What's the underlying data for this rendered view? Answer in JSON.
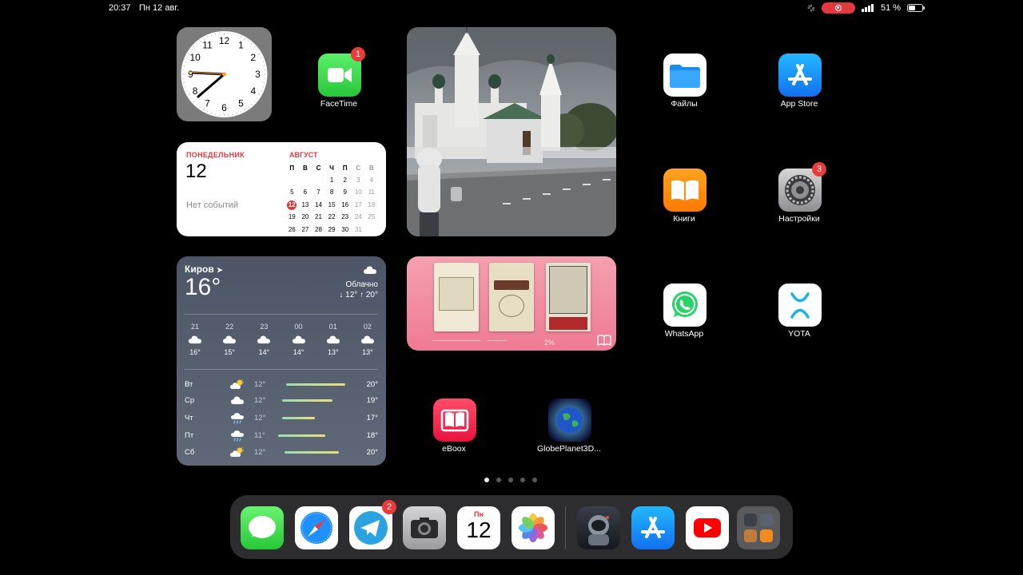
{
  "status": {
    "time": "20:37",
    "date": "Пн 12 авг.",
    "battery_percent": "51 %",
    "battery_level": 0.51
  },
  "clock_widget": {
    "numbers": [
      "12",
      "1",
      "2",
      "3",
      "4",
      "5",
      "6",
      "7",
      "8",
      "9",
      "10",
      "11"
    ]
  },
  "calendar_widget": {
    "weekday": "ПОНЕДЕЛЬНИК",
    "day": "12",
    "no_events": "Нет событий",
    "month": "АВГУСТ",
    "weekday_headers": [
      "П",
      "В",
      "С",
      "Ч",
      "П",
      "С",
      "В"
    ],
    "weeks": [
      [
        "",
        "",
        "",
        "1",
        "2",
        "3",
        "4"
      ],
      [
        "5",
        "6",
        "7",
        "8",
        "9",
        "10",
        "11"
      ],
      [
        "12",
        "13",
        "14",
        "15",
        "16",
        "17",
        "18"
      ],
      [
        "19",
        "20",
        "21",
        "22",
        "23",
        "24",
        "25"
      ],
      [
        "26",
        "27",
        "28",
        "29",
        "30",
        "31",
        ""
      ]
    ],
    "today": "12"
  },
  "weather_widget": {
    "city": "Киров",
    "temp": "16°",
    "condition": "Облачно",
    "hilo": "↓ 12° ↑ 20°",
    "hourly": [
      {
        "hour": "21",
        "temp": "16°"
      },
      {
        "hour": "22",
        "temp": "15°"
      },
      {
        "hour": "23",
        "temp": "14°"
      },
      {
        "hour": "00",
        "temp": "14°"
      },
      {
        "hour": "01",
        "temp": "13°"
      },
      {
        "hour": "02",
        "temp": "13°"
      }
    ],
    "daily": [
      {
        "day": "Вт",
        "icon": "partly-cloudy",
        "min": "12°",
        "max": "20°",
        "bar_start": 0.1,
        "bar_end": 0.88
      },
      {
        "day": "Ср",
        "icon": "cloud",
        "min": "12°",
        "max": "19°",
        "bar_start": 0.05,
        "bar_end": 0.72
      },
      {
        "day": "Чт",
        "icon": "rain",
        "min": "12°",
        "max": "17°",
        "bar_start": 0.05,
        "bar_end": 0.48
      },
      {
        "day": "Пт",
        "icon": "rain",
        "min": "11°",
        "max": "18°",
        "bar_start": 0.0,
        "bar_end": 0.62
      },
      {
        "day": "Сб",
        "icon": "partly-cloudy",
        "min": "12°",
        "max": "20°",
        "bar_start": 0.08,
        "bar_end": 0.8
      }
    ]
  },
  "books_widget": {
    "progress": "2%"
  },
  "apps": {
    "facetime": {
      "label": "FaceTime",
      "badge": "1"
    },
    "files": {
      "label": "Файлы"
    },
    "appstore": {
      "label": "App Store"
    },
    "books": {
      "label": "Книги"
    },
    "settings": {
      "label": "Настройки",
      "badge": "3"
    },
    "whatsapp": {
      "label": "WhatsApp"
    },
    "yota": {
      "label": "YOTA"
    },
    "eboox": {
      "label": "eBoox"
    },
    "globeplanet": {
      "label": "GlobePlanet3D..."
    }
  },
  "dock": {
    "telegram_badge": "2",
    "calendar_weekday": "Пн",
    "calendar_day": "12"
  },
  "page_dots": {
    "count": 5,
    "active": 1
  }
}
